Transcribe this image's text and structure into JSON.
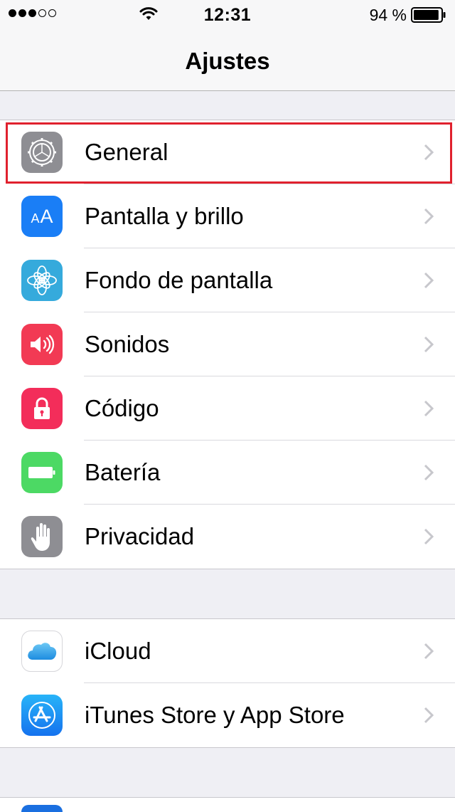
{
  "status_bar": {
    "signal_bars_filled": 3,
    "signal_bars_total": 5,
    "time": "12:31",
    "battery_percent": "94 %",
    "battery_level": 0.94,
    "icons": [
      "signal-dots",
      "wifi-icon",
      "battery-icon"
    ]
  },
  "nav": {
    "title": "Ajustes"
  },
  "groups": [
    {
      "rows": [
        {
          "label": "General",
          "icon": "gear-icon",
          "color": "#8e8e93",
          "highlighted": true
        },
        {
          "label": "Pantalla y brillo",
          "icon": "text-size-icon",
          "color": "#1a7ef6"
        },
        {
          "label": "Fondo de pantalla",
          "icon": "flower-icon",
          "color": "#35aadc"
        },
        {
          "label": "Sonidos",
          "icon": "speaker-icon",
          "color": "#f23a54"
        },
        {
          "label": "Código",
          "icon": "lock-icon",
          "color": "#f32d5a"
        },
        {
          "label": "Batería",
          "icon": "battery-icon",
          "color": "#4cd964"
        },
        {
          "label": "Privacidad",
          "icon": "hand-icon",
          "color": "#8e8e93"
        }
      ]
    },
    {
      "rows": [
        {
          "label": "iCloud",
          "icon": "cloud-icon",
          "color": "#ffffff"
        },
        {
          "label": "iTunes Store y App Store",
          "icon": "app-store-icon",
          "color": "#1e8ff5"
        }
      ]
    }
  ],
  "highlight_color": "#e0212e"
}
